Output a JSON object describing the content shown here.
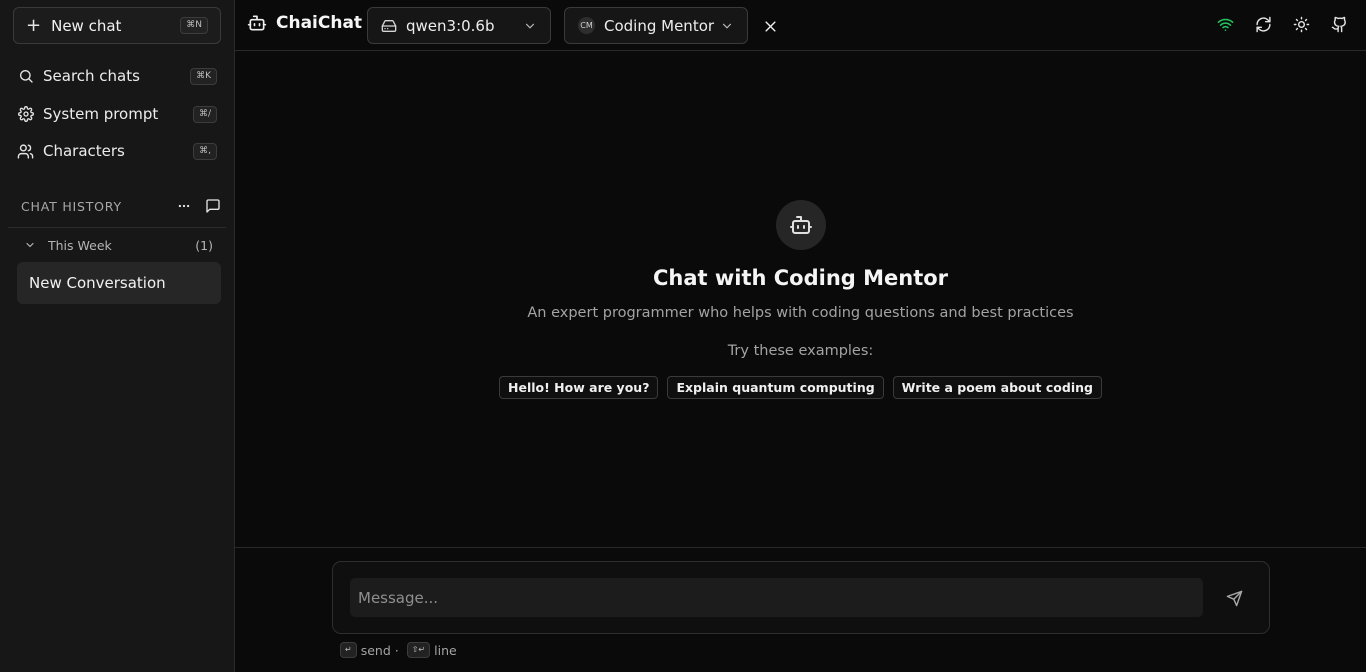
{
  "sidebar": {
    "new_chat_label": "New chat",
    "new_chat_shortcut": "⌘N",
    "nav": [
      {
        "label": "Search chats",
        "shortcut": "⌘K",
        "icon": "search-icon"
      },
      {
        "label": "System prompt",
        "shortcut": "⌘/",
        "icon": "gear-icon"
      },
      {
        "label": "Characters",
        "shortcut": "⌘,",
        "icon": "users-icon"
      }
    ],
    "history_title": "CHAT HISTORY",
    "group": {
      "label": "This Week",
      "count": "(1)"
    },
    "conversations": [
      {
        "title": "New Conversation"
      }
    ]
  },
  "header": {
    "app_name": "ChaiChat",
    "model": "qwen3:0.6b",
    "character_initials": "CM",
    "character": "Coding Mentor",
    "status_color": "#22c55e"
  },
  "main": {
    "title": "Chat with Coding Mentor",
    "subtitle": "An expert programmer who helps with coding questions and best practices",
    "examples_title": "Try these examples:",
    "examples": [
      "Hello! How are you?",
      "Explain quantum computing",
      "Write a poem about coding"
    ]
  },
  "composer": {
    "placeholder": "Message...",
    "hint_send_key": "↵",
    "hint_send": "send ·",
    "hint_line_key": "⇧↵",
    "hint_line": "line"
  }
}
